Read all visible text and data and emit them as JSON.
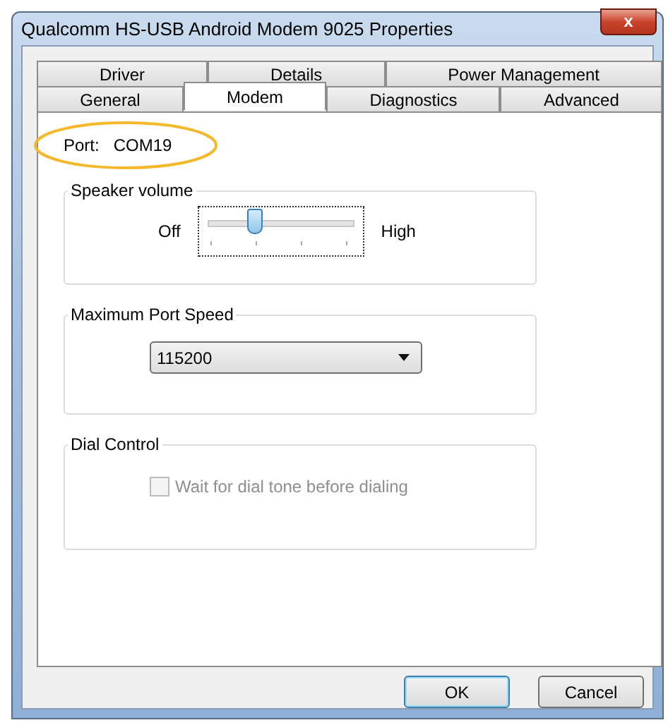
{
  "window": {
    "title": "Qualcomm HS-USB Android Modem 9025 Properties",
    "close": "x"
  },
  "tab_rows": [
    [
      {
        "label": "Driver",
        "selected": false
      },
      {
        "label": "Details",
        "selected": false
      },
      {
        "label": "Power Management",
        "selected": false
      }
    ],
    [
      {
        "label": "General",
        "selected": false
      },
      {
        "label": "Modem",
        "selected": true
      },
      {
        "label": "Diagnostics",
        "selected": false
      },
      {
        "label": "Advanced",
        "selected": false
      }
    ]
  ],
  "port": {
    "label": "Port:",
    "value": "COM19"
  },
  "speaker_volume": {
    "title": "Speaker volume",
    "min_label": "Off",
    "max_label": "High",
    "level": 0.333
  },
  "max_port_speed": {
    "title": "Maximum Port Speed",
    "value": "115200"
  },
  "dial_control": {
    "title": "Dial Control",
    "checkbox": {
      "label": "Wait for dial tone before dialing",
      "checked": false,
      "disabled": true
    }
  },
  "buttons": [
    {
      "label": "OK",
      "default": true
    },
    {
      "label": "Cancel",
      "default": false
    }
  ]
}
